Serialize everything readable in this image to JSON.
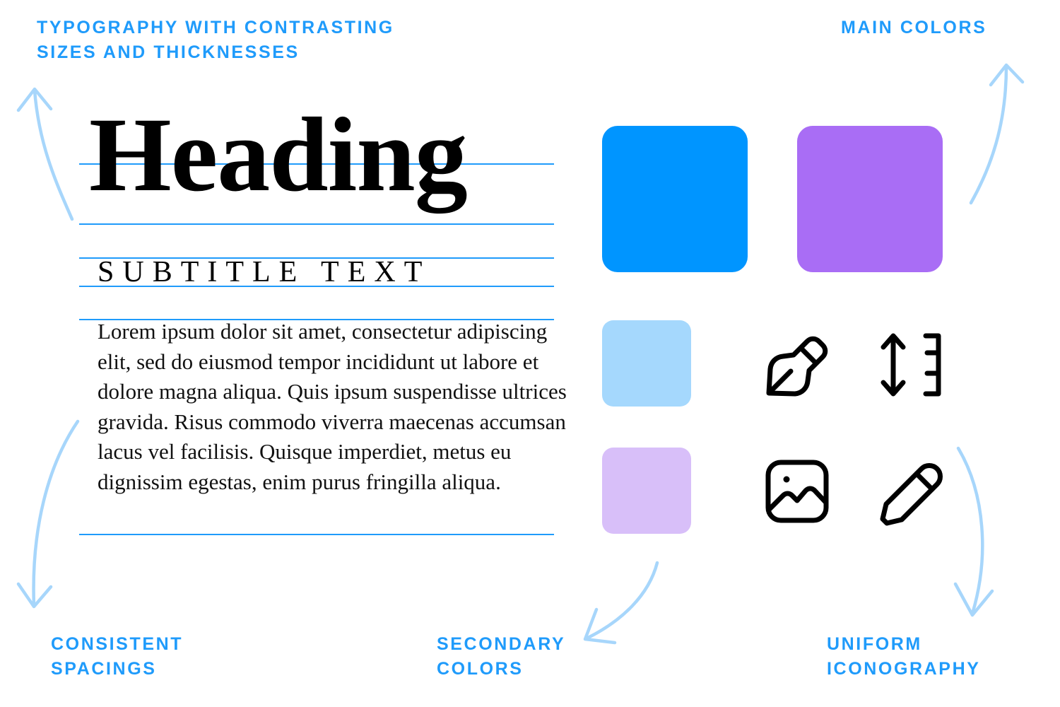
{
  "page": {
    "background": "#ffffff",
    "accent_blue": "#1f9bfb",
    "arrow_blue": "#a7d6fb"
  },
  "callouts": {
    "typography": "TYPOGRAPHY WITH CONTRASTING\nSIZES AND THICKNESSES",
    "main_colors": "MAIN COLORS",
    "consistent_spacings": "CONSISTENT\nSPACINGS",
    "secondary_colors": "SECONDARY\nCOLORS",
    "uniform_iconography": "UNIFORM\nICONOGRAPHY"
  },
  "typography": {
    "heading": "Heading",
    "subtitle": "SUBTITLE TEXT",
    "body": "Lorem ipsum dolor sit amet, consectetur adipiscing elit, sed do eiusmod tempor incididunt ut labore et dolore magna aliqua. Quis ipsum suspendisse ultrices gravida. Risus commodo viverra maecenas accumsan lacus vel facilisis. Quisque imperdiet, metus eu dignissim egestas, enim purus fringilla aliqua.",
    "guide_line_color": "#1f9bfb"
  },
  "colors": {
    "main": [
      {
        "name": "primary-blue",
        "hex": "#0095FF"
      },
      {
        "name": "primary-purple",
        "hex": "#A96DF5"
      }
    ],
    "secondary": [
      {
        "name": "secondary-light-blue",
        "hex": "#A5D8FD"
      },
      {
        "name": "secondary-light-purple",
        "hex": "#D8BFF9"
      }
    ]
  },
  "icons": [
    {
      "name": "pen-nib-icon",
      "label": "pen nib"
    },
    {
      "name": "line-height-icon",
      "label": "line height"
    },
    {
      "name": "image-icon",
      "label": "image"
    },
    {
      "name": "pencil-icon",
      "label": "pencil"
    }
  ]
}
